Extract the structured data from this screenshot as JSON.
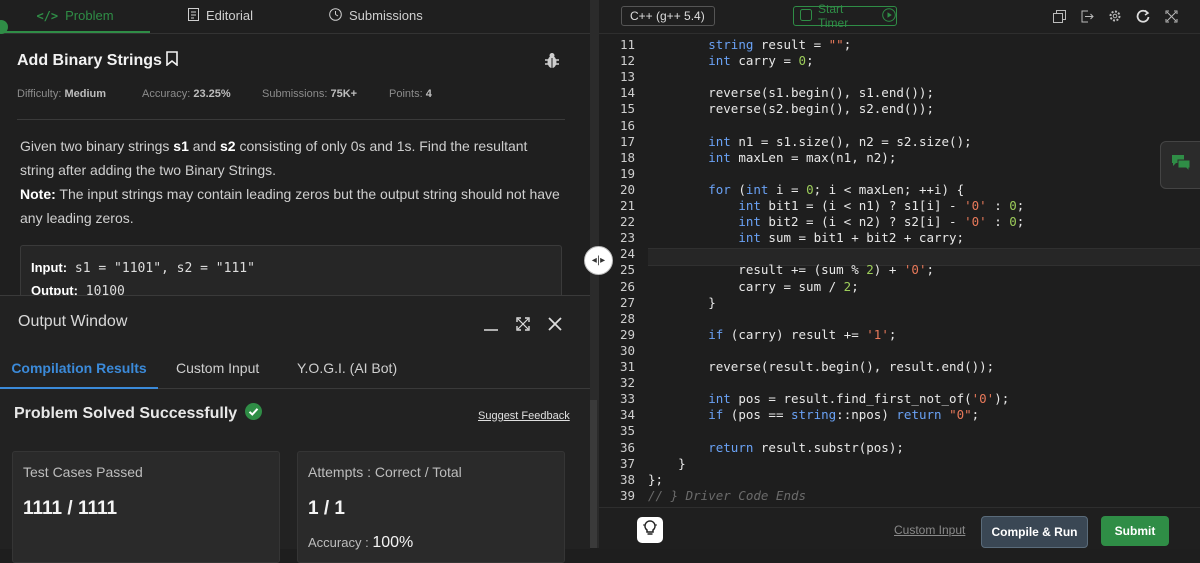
{
  "tabs": [
    {
      "icon": "code-icon",
      "label": "Problem"
    },
    {
      "icon": "document-icon",
      "label": "Editorial"
    },
    {
      "icon": "clock-icon",
      "label": "Submissions"
    }
  ],
  "problem": {
    "title": "Add Binary Strings",
    "difficulty_label": "Difficulty:",
    "difficulty": "Medium",
    "accuracy_label": "Accuracy:",
    "accuracy": "23.25%",
    "submissions_label": "Submissions:",
    "submissions": "75K+",
    "points_label": "Points:",
    "points": "4",
    "desc1_a": "Given two binary strings ",
    "desc1_b": "s1",
    "desc1_c": " and ",
    "desc1_d": "s2",
    "desc1_e": " consisting of only 0s and 1s. Find the resultant string after adding the two Binary Strings.",
    "note_label": "Note:",
    "note_text": " The input strings may contain leading zeros but the output string should not have any leading zeros.",
    "example_input_label": "Input:",
    "example_input": "s1 = \"1101\", s2 = \"111\"",
    "example_output_label": "Output:",
    "example_output": "10100"
  },
  "output": {
    "title": "Output Window",
    "tabs": [
      "Compilation Results",
      "Custom Input",
      "Y.O.G.I. (AI Bot)"
    ],
    "status": "Problem Solved Successfully",
    "feedback": "Suggest Feedback",
    "cards": [
      {
        "label": "Test Cases Passed",
        "value": "1111 / 1111"
      },
      {
        "label": "Attempts : Correct / Total",
        "value": "1 / 1",
        "accuracy_label": "Accuracy :",
        "accuracy": "100%"
      }
    ]
  },
  "editor": {
    "language": "C++ (g++ 5.4)",
    "timer": "Start Timer",
    "toolbar_icons": [
      "copy-icon",
      "exit-icon",
      "settings-icon",
      "reset-icon",
      "fullscreen-icon"
    ],
    "lines": [
      {
        "n": "11",
        "t": "        string result = \"\";"
      },
      {
        "n": "12",
        "t": "        int carry = 0;"
      },
      {
        "n": "13",
        "t": ""
      },
      {
        "n": "14",
        "t": "        reverse(s1.begin(), s1.end());"
      },
      {
        "n": "15",
        "t": "        reverse(s2.begin(), s2.end());"
      },
      {
        "n": "16",
        "t": ""
      },
      {
        "n": "17",
        "t": "        int n1 = s1.size(), n2 = s2.size();"
      },
      {
        "n": "18",
        "t": "        int maxLen = max(n1, n2);"
      },
      {
        "n": "19",
        "t": ""
      },
      {
        "n": "20",
        "t": "        for (int i = 0; i < maxLen; ++i) {"
      },
      {
        "n": "21",
        "t": "            int bit1 = (i < n1) ? s1[i] - '0' : 0;"
      },
      {
        "n": "22",
        "t": "            int bit2 = (i < n2) ? s2[i] - '0' : 0;"
      },
      {
        "n": "23",
        "t": "            int sum = bit1 + bit2 + carry;"
      },
      {
        "n": "24",
        "t": "            "
      },
      {
        "n": "25",
        "t": "            result += (sum % 2) + '0';"
      },
      {
        "n": "26",
        "t": "            carry = sum / 2;"
      },
      {
        "n": "27",
        "t": "        }"
      },
      {
        "n": "28",
        "t": ""
      },
      {
        "n": "29",
        "t": "        if (carry) result += '1';"
      },
      {
        "n": "30",
        "t": ""
      },
      {
        "n": "31",
        "t": "        reverse(result.begin(), result.end());"
      },
      {
        "n": "32",
        "t": ""
      },
      {
        "n": "33",
        "t": "        int pos = result.find_first_not_of('0');"
      },
      {
        "n": "34",
        "t": "        if (pos == string::npos) return \"0\";"
      },
      {
        "n": "35",
        "t": ""
      },
      {
        "n": "36",
        "t": "        return result.substr(pos);"
      },
      {
        "n": "37",
        "t": "    }"
      },
      {
        "n": "38",
        "t": "};"
      },
      {
        "n": "39",
        "t": "// } Driver Code Ends"
      }
    ],
    "custom_input": "Custom Input",
    "compile_run": "Compile & Run",
    "submit": "Submit"
  }
}
